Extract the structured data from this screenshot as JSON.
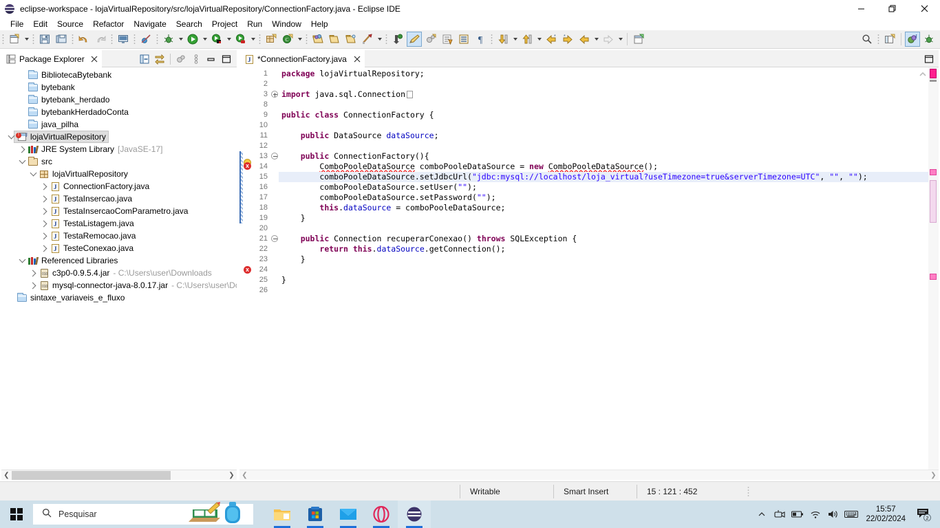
{
  "window": {
    "title": "eclipse-workspace - lojaVirtualRepository/src/lojaVirtualRepository/ConnectionFactory.java - Eclipse IDE",
    "icon": "eclipse-globe-icon",
    "minimize": "–",
    "maximize": "❐",
    "close": "✕"
  },
  "menubar": {
    "items": [
      {
        "label": "File"
      },
      {
        "label": "Edit"
      },
      {
        "label": "Source"
      },
      {
        "label": "Refactor"
      },
      {
        "label": "Navigate"
      },
      {
        "label": "Search"
      },
      {
        "label": "Project"
      },
      {
        "label": "Run"
      },
      {
        "label": "Window"
      },
      {
        "label": "Help"
      }
    ]
  },
  "package_explorer": {
    "tab_label": "Package Explorer",
    "tab_icon": "package-explorer-icon",
    "close_icon": "close-icon",
    "toolbar": [
      {
        "name": "collapse-all-icon"
      },
      {
        "name": "link-with-editor-icon"
      },
      {
        "name": "view-menu-filters-icon"
      },
      {
        "name": "view-menu-icon"
      },
      {
        "name": "minimize-view-icon"
      },
      {
        "name": "maximize-view-icon"
      }
    ],
    "tree": [
      {
        "label": "BibliotecaBytebank",
        "icon": "folder-icon",
        "indent": 1,
        "twisty": "none",
        "selected": false
      },
      {
        "label": "bytebank",
        "icon": "folder-icon",
        "indent": 1,
        "twisty": "none",
        "selected": false
      },
      {
        "label": "bytebank_herdado",
        "icon": "folder-icon",
        "indent": 1,
        "twisty": "none",
        "selected": false
      },
      {
        "label": "bytebankHerdadoConta",
        "icon": "folder-icon",
        "indent": 1,
        "twisty": "none",
        "selected": false
      },
      {
        "label": "java_pilha",
        "icon": "folder-icon",
        "indent": 1,
        "twisty": "none",
        "selected": false
      },
      {
        "label": "lojaVirtualRepository",
        "icon": "java-project-error-icon",
        "indent": 0,
        "twisty": "down",
        "selected": true
      },
      {
        "label": "JRE System Library",
        "suffix": "[JavaSE-17]",
        "icon": "jre-library-icon",
        "indent": 1,
        "twisty": "right",
        "selected": false
      },
      {
        "label": "src",
        "icon": "source-folder-icon",
        "indent": 1,
        "twisty": "down",
        "selected": false
      },
      {
        "label": "lojaVirtualRepository",
        "icon": "package-icon",
        "indent": 2,
        "twisty": "down",
        "selected": false
      },
      {
        "label": "ConnectionFactory.java",
        "icon": "java-file-icon",
        "indent": 3,
        "twisty": "right",
        "selected": false
      },
      {
        "label": "TestaInsercao.java",
        "icon": "java-file-icon",
        "indent": 3,
        "twisty": "right",
        "selected": false
      },
      {
        "label": "TestaInsercaoComParametro.java",
        "icon": "java-file-icon",
        "indent": 3,
        "twisty": "right",
        "selected": false
      },
      {
        "label": "TestaListagem.java",
        "icon": "java-file-icon",
        "indent": 3,
        "twisty": "right",
        "selected": false
      },
      {
        "label": "TestaRemocao.java",
        "icon": "java-file-icon",
        "indent": 3,
        "twisty": "right",
        "selected": false
      },
      {
        "label": "TesteConexao.java",
        "icon": "java-file-icon",
        "indent": 3,
        "twisty": "right",
        "selected": false
      },
      {
        "label": "Referenced Libraries",
        "icon": "library-icon",
        "indent": 1,
        "twisty": "down",
        "selected": false
      },
      {
        "label": "c3p0-0.9.5.4.jar",
        "path": "- C:\\Users\\user\\Downloads",
        "icon": "jar-icon",
        "indent": 2,
        "twisty": "right",
        "selected": false
      },
      {
        "label": "mysql-connector-java-8.0.17.jar",
        "path": "- C:\\Users\\user\\Dc",
        "icon": "jar-icon",
        "indent": 2,
        "twisty": "right",
        "selected": false
      },
      {
        "label": "sintaxe_variaveis_e_fluxo",
        "icon": "folder-icon",
        "indent": 0,
        "twisty": "none",
        "selected": false
      }
    ]
  },
  "editor": {
    "tab_label": "*ConnectionFactory.java",
    "tab_icon": "java-file-icon",
    "close_icon": "close-icon",
    "restore_icon": "restore-view-icon",
    "lines": [
      {
        "n": "1",
        "indent": 0
      },
      {
        "n": "2",
        "indent": 0
      },
      {
        "n": "3",
        "indent": 0,
        "fold": "plus"
      },
      {
        "n": "8",
        "indent": 0
      },
      {
        "n": "9",
        "indent": 0
      },
      {
        "n": "10",
        "indent": 0
      },
      {
        "n": "11",
        "indent": 0
      },
      {
        "n": "12",
        "indent": 0
      },
      {
        "n": "13",
        "indent": 0,
        "fold": "minus"
      },
      {
        "n": "14",
        "indent": 0
      },
      {
        "n": "15",
        "indent": 0,
        "highlight": true
      },
      {
        "n": "16",
        "indent": 0
      },
      {
        "n": "17",
        "indent": 0
      },
      {
        "n": "18",
        "indent": 0
      },
      {
        "n": "19",
        "indent": 0
      },
      {
        "n": "20",
        "indent": 0
      },
      {
        "n": "21",
        "indent": 0,
        "fold": "minus"
      },
      {
        "n": "22",
        "indent": 0
      },
      {
        "n": "23",
        "indent": 0
      },
      {
        "n": "24",
        "indent": 0
      },
      {
        "n": "25",
        "indent": 0
      },
      {
        "n": "26",
        "indent": 0
      }
    ],
    "code_plain": [
      "package lojaVirtualRepository;",
      "",
      "import java.sql.Connection;",
      "",
      "public class ConnectionFactory {",
      "",
      "    public DataSource dataSource;",
      "",
      "    public ConnectionFactory(){",
      "        ComboPooleDataSource comboPooleDataSource = new ComboPooleDataSource();",
      "        comboPooleDataSource.setJdbcUrl(\"jdbc:mysql://localhost/loja_virtual?useTimezone=true&serverTimezone=UTC\", \"\", \"\");",
      "        comboPooleDataSource.setUser(\"\");",
      "        comboPooleDataSource.setPassword(\"\");",
      "        this.dataSource = comboPooleDataSource;",
      "    }",
      "",
      "    public Connection recuperarConexao() throws SQLException {",
      "        return this.dataSource.getConnection();",
      "    }",
      "",
      "}",
      "",
      ""
    ],
    "markers": {
      "line14": "warning-error-marker",
      "line24": "error-marker"
    }
  },
  "statusbar": {
    "writable": "Writable",
    "insert_mode": "Smart Insert",
    "position": "15 : 121 : 452"
  },
  "taskbar": {
    "start_icon": "windows-start-icon",
    "search_placeholder": "Pesquisar",
    "search_icon": "search-icon",
    "apps": [
      {
        "name": "file-explorer-icon",
        "active": false,
        "running": true
      },
      {
        "name": "microsoft-store-icon",
        "active": false,
        "running": true
      },
      {
        "name": "mail-icon",
        "active": false,
        "running": true
      },
      {
        "name": "opera-icon",
        "active": false,
        "running": true
      },
      {
        "name": "eclipse-icon",
        "active": true,
        "running": true
      }
    ],
    "tray": [
      {
        "name": "show-hidden-icons-chevron"
      },
      {
        "name": "camera-icon"
      },
      {
        "name": "battery-icon"
      },
      {
        "name": "wifi-icon"
      },
      {
        "name": "volume-icon"
      },
      {
        "name": "keyboard-icon"
      }
    ],
    "clock_time": "15:57",
    "clock_date": "22/02/2024",
    "notification_count": "2"
  },
  "colors": {
    "keyword": "#7f0055",
    "string": "#2a00ff",
    "field": "#0000c0",
    "selection": "#e8eef9",
    "error": "#dd2c2c",
    "taskbar": "#cfe0ea",
    "toolbar": "#f0f0f0"
  }
}
